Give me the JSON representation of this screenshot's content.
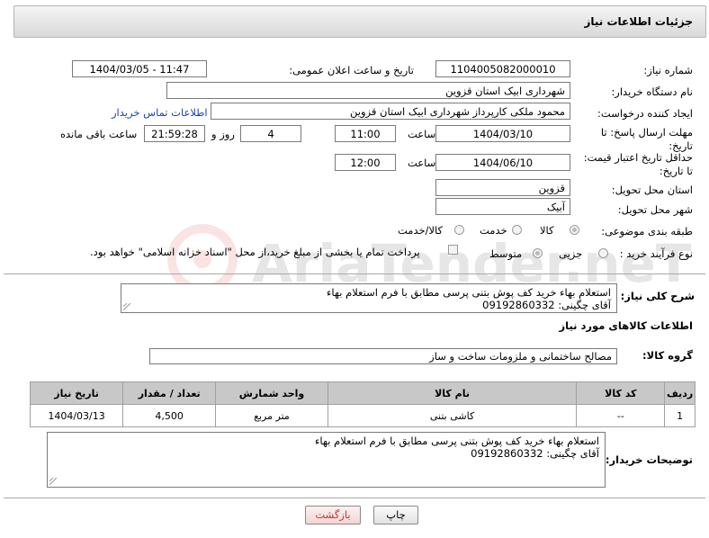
{
  "header": {
    "title": "جزئیات اطلاعات نیاز"
  },
  "form": {
    "need_number_label": "شماره نیاز:",
    "need_number": "1104005082000010",
    "announce_label": "تاریخ و ساعت اعلان عمومی:",
    "announce_value": "1404/03/05 - 11:47",
    "buyer_org_label": "نام دستگاه خریدار:",
    "buyer_org": "شهرداری ابیک استان قزوین",
    "creator_label": "ایجاد کننده درخواست:",
    "creator": "محمود ملکی کارپرداز شهرداری ابیک استان قزوین",
    "contact_link": "اطلاعات تماس خریدار",
    "deadline_label": "مهلت ارسال پاسخ: تا تاریخ:",
    "deadline_date": "1404/03/10",
    "time_label": "ساعت",
    "deadline_time": "11:00",
    "days": "4",
    "days_label": "روز و",
    "remaining": "21:59:28",
    "remaining_label": "ساعت باقی مانده",
    "price_validity_label": "حداقل تاریخ اعتبار قیمت: تا تاریخ:",
    "price_validity_date": "1404/06/10",
    "price_validity_time": "12:00",
    "delivery_province_label": "استان محل تحویل:",
    "delivery_province": "قزوین",
    "delivery_city_label": "شهر محل تحویل:",
    "delivery_city": "آبیک",
    "category_label": "طبقه بندی موضوعی:",
    "category_options": [
      "کالا",
      "خدمت",
      "کالا/خدمت"
    ],
    "process_label": "نوع فرآیند خرید :",
    "process_options": [
      "جزیی",
      "متوسط"
    ],
    "payment_note": "پرداخت تمام یا بخشی از مبلغ خرید،از محل \"اسناد خزانه اسلامی\" خواهد بود.",
    "description_label": "شرح کلی نیاز:",
    "description_line1": "استعلام بهاء خرید کف پوش بتنی پرسی مطابق با فرم استعلام بهاء",
    "description_line2": "آقای چگینی: 09192860332"
  },
  "goods": {
    "section_title": "اطلاعات کالاهای مورد نیاز",
    "group_label": "گروه کالا:",
    "group_value": "مصالح ساختمانی و ملزومات ساخت و ساز",
    "columns": [
      "ردیف",
      "کد کالا",
      "نام کالا",
      "واحد شمارش",
      "تعداد / مقدار",
      "تاریخ نیاز"
    ],
    "rows": [
      {
        "row": "1",
        "code": "--",
        "name": "کاشی بتنی",
        "unit": "متر مربع",
        "qty": "4,500",
        "date": "1404/03/13"
      }
    ]
  },
  "buyer_notes": {
    "label": "توضیحات خریدار:",
    "line1": "استعلام بهاء خرید کف پوش بتنی پرسی مطابق با فرم استعلام بهاء",
    "line2": "آقای چگینی: 09192860332"
  },
  "buttons": {
    "print": "چاپ",
    "back": "بازگشت"
  },
  "watermark": {
    "text": "AriaTender.neT"
  },
  "colors": {
    "link": "#1a44b8",
    "header_bg": "#d9d9d9",
    "table_header_bg": "#c8c8c8",
    "back_button_text": "#c0392b"
  }
}
